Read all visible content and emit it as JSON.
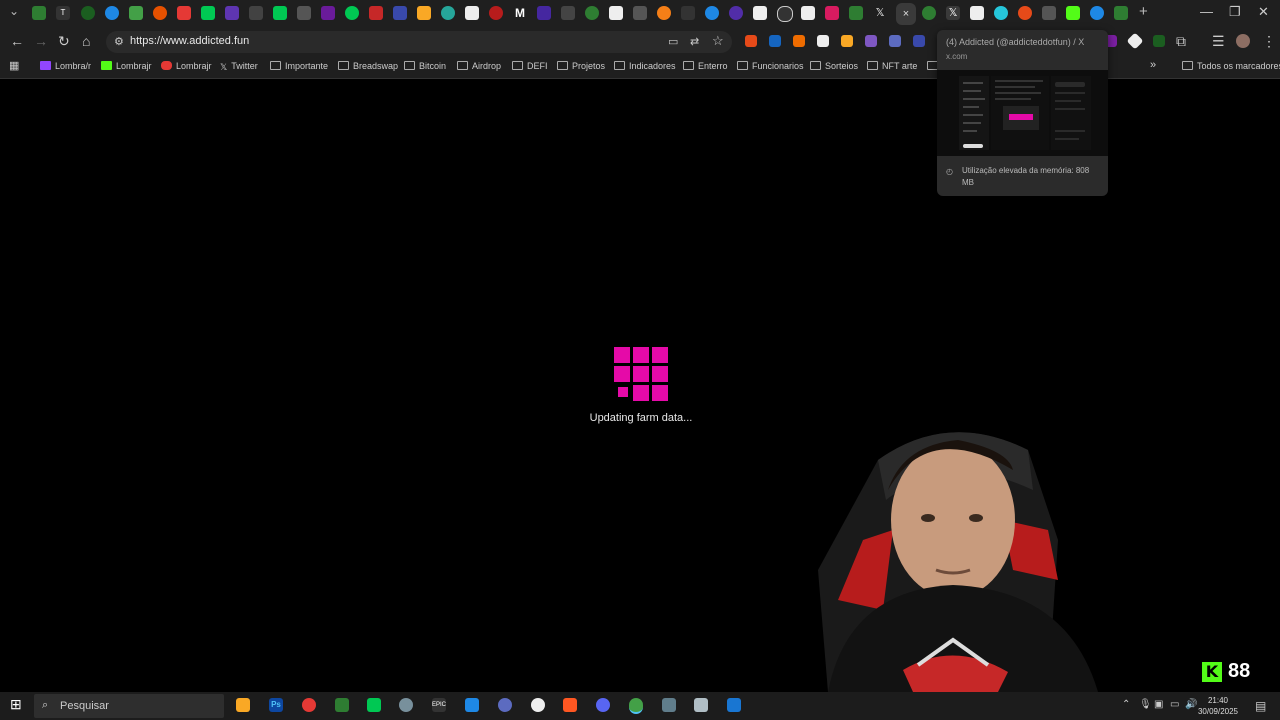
{
  "browser": {
    "url": "https://www.addicted.fun",
    "active_tab_close": "×",
    "new_tab": "+"
  },
  "tooltip": {
    "title": "(4) Addicted (@addicteddotfun) / X",
    "domain": "x.com",
    "memory": "Utilização elevada da memória: 808 MB"
  },
  "bookmarks": {
    "items": [
      {
        "label": "Lombra/r",
        "icon": "twitch-icon"
      },
      {
        "label": "Lombrajr",
        "icon": "kick-icon"
      },
      {
        "label": "Lombrajr",
        "icon": "youtube-icon"
      },
      {
        "label": "Twitter",
        "icon": "x-icon"
      },
      {
        "label": "Importante",
        "icon": "folder-icon"
      },
      {
        "label": "Breadswap",
        "icon": "folder-icon"
      },
      {
        "label": "Bitcoin",
        "icon": "folder-icon"
      },
      {
        "label": "Airdrop",
        "icon": "folder-icon"
      },
      {
        "label": "DEFI",
        "icon": "folder-icon"
      },
      {
        "label": "Projetos",
        "icon": "folder-icon"
      },
      {
        "label": "Indicadores",
        "icon": "folder-icon"
      },
      {
        "label": "Enterro",
        "icon": "folder-icon"
      },
      {
        "label": "Funcionarios",
        "icon": "folder-icon"
      },
      {
        "label": "Sorteios",
        "icon": "folder-icon"
      },
      {
        "label": "NFT arte",
        "icon": "folder-icon"
      }
    ],
    "all_bookmarks": "Todos os marcadores",
    "overflow": "»"
  },
  "page": {
    "loading_text": "Updating farm data...",
    "accent": "#e50aa8"
  },
  "kick": {
    "logo": "K",
    "viewer_count": "88"
  },
  "taskbar": {
    "search_placeholder": "Pesquisar",
    "time": "21:40",
    "date": "30/09/2025"
  }
}
